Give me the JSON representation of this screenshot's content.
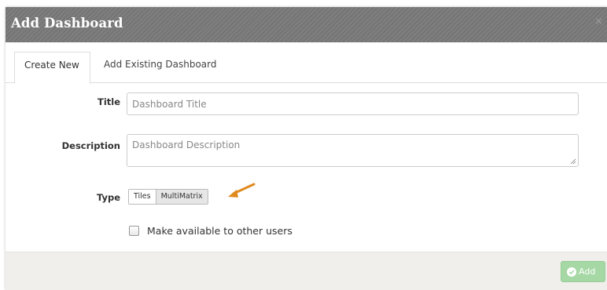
{
  "dialog": {
    "title": "Add Dashboard",
    "close_symbol": "×"
  },
  "tabs": [
    {
      "label": "Create New",
      "active": true
    },
    {
      "label": "Add Existing Dashboard",
      "active": false
    }
  ],
  "form": {
    "title_label": "Title",
    "title_placeholder": "Dashboard Title",
    "description_label": "Description",
    "description_placeholder": "Dashboard Description",
    "type_label": "Type",
    "type_options": [
      {
        "label": "Tiles",
        "selected": false
      },
      {
        "label": "MultiMatrix",
        "selected": true
      }
    ],
    "share_label": "Make available to other users",
    "share_checked": false
  },
  "footer": {
    "add_label": "Add"
  },
  "colors": {
    "header_bg": "#7a7a7a",
    "add_button_bg": "#a6d8a6",
    "arrow": "#e08a1e"
  },
  "icons": {
    "close": "close-icon",
    "add": "check-circle-icon",
    "annotation": "arrow-annotation-icon"
  }
}
